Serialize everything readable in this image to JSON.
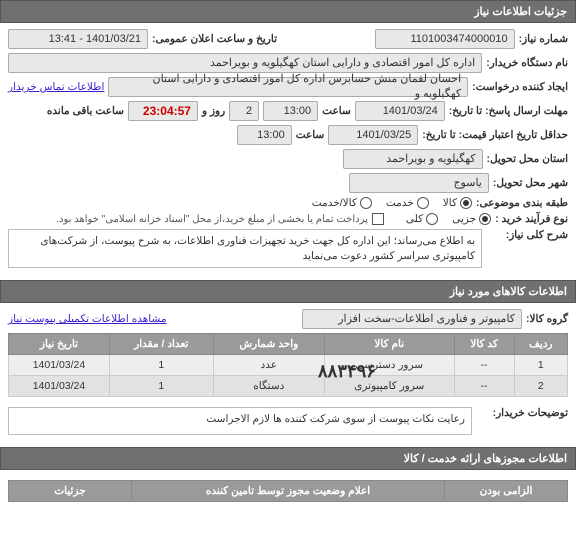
{
  "sections": {
    "detailsHeader": "جزئیات اطلاعات نیاز",
    "itemsHeader": "اطلاعات کالاهای مورد نیاز",
    "licensesHeader": "اطلاعات مجوزهای ارائه خدمت / کالا"
  },
  "form": {
    "reqNumLabel": "شماره نیاز:",
    "reqNum": "1101003474000010",
    "announceLabel": "تاریخ و ساعت اعلان عمومی:",
    "announceVal": "1401/03/21 - 13:41",
    "buyerOrgLabel": "نام دستگاه خریدار:",
    "buyerOrg": "اداره کل امور اقتصادی و دارایی استان کهگیلویه و بویراحمد",
    "creatorLabel": "ایجاد کننده درخواست:",
    "creator": "احسان لقمان منش حسابرس اداره کل امور اقتصادی و دارایی استان کهگیلویه و",
    "contactLink": "اطلاعات تماس خریدار",
    "deadlineLabel": "مهلت ارسال پاسخ: تا تاریخ:",
    "deadlineDate": "1401/03/24",
    "hourLabel": "ساعت",
    "deadlineHour": "13:00",
    "dayLabel": "روز و",
    "dayVal": "2",
    "remainLabel": "ساعت باقی مانده",
    "remainVal": "23:04:57",
    "validUntilLabel": "حداقل تاریخ اعتبار قیمت: تا تاریخ:",
    "validDate": "1401/03/25",
    "validHour": "13:00",
    "provinceLabel": "استان محل تحویل:",
    "province": "کهگیلویه و بویراحمد",
    "cityLabel": "شهر محل تحویل:",
    "city": "یاسوج",
    "classifyLabel": "طبقه بندی موضوعی:",
    "classify": {
      "goods": "کالا",
      "service": "خدمت",
      "goodsService": "کالا/خدمت"
    },
    "purchaseTypeLabel": "نوع فرآیند خرید :",
    "purchaseType": {
      "partial": "جزیی",
      "full": "کلی"
    },
    "paymentNote": "پرداخت تمام یا بخشی از مبلغ خرید،از محل \"اسناد خزانه اسلامی\" خواهد بود.",
    "generalDescLabel": "شرح کلی نیاز:",
    "generalDesc": "به اطلاع می‌رساند؛ این اداره کل جهت خرید تجهیزات فناوری اطلاعات، به شرح پیوست، از شرکت‌های کامپیوتری سراسر کشور دعوت می‌نماید",
    "groupLabel": "گروه کالا:",
    "group": "کامپیوتر و فناوری اطلاعات-سخت افزار",
    "attachLink": "مشاهده اطلاعات تکمیلی پیوست نیاز",
    "buyerNotesLabel": "توضیحات خریدار:",
    "buyerNotes": "رعایت نکات پیوست از سوی شرکت کننده ها لازم الاجراست",
    "bigNumber": "۸۸۳۴۹۶"
  },
  "itemsTable": {
    "headers": {
      "row": "ردیف",
      "code": "کد کالا",
      "name": "نام کالا",
      "unit": "واحد شمارش",
      "qty": "تعداد / مقدار",
      "date": "تاریخ نیاز"
    },
    "rows": [
      {
        "row": "1",
        "code": "--",
        "name": "سرور دسترسی",
        "unit": "عدد",
        "qty": "1",
        "date": "1401/03/24"
      },
      {
        "row": "2",
        "code": "--",
        "name": "سرور کامپیوتری",
        "unit": "دستگاه",
        "qty": "1",
        "date": "1401/03/24"
      }
    ]
  },
  "footer": {
    "licenseTable": {
      "mandatory": "الزامی بودن",
      "announce": "اعلام وضعیت مجوز توسط تامین کننده",
      "details": "جزئیات"
    }
  }
}
